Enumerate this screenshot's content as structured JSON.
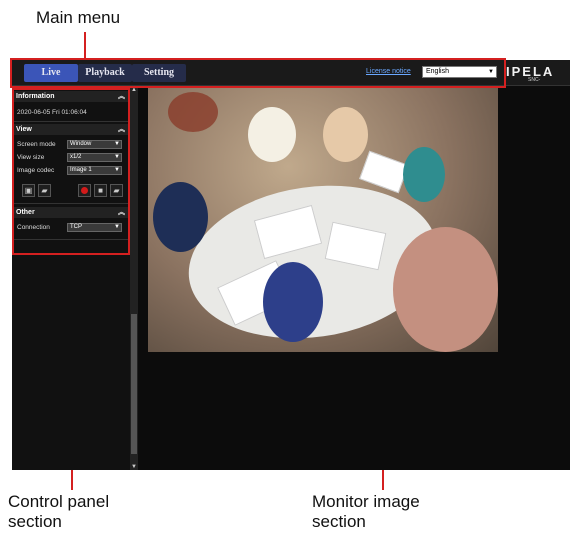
{
  "callouts": {
    "main_menu": "Main menu",
    "control_panel_line1": "Control panel",
    "control_panel_line2": "section",
    "monitor_line1": "Monitor image",
    "monitor_line2": "section"
  },
  "menu": {
    "tabs": [
      {
        "label": "Live",
        "active": true
      },
      {
        "label": "Playback",
        "active": false
      },
      {
        "label": "Setting",
        "active": false
      }
    ],
    "license_link": "License notice",
    "language": "English",
    "logo": "IPELA",
    "logo_sub": "SNC-"
  },
  "panel": {
    "information": {
      "title": "Information",
      "datetime": "2020-06-05 Fri 01:06:04"
    },
    "view": {
      "title": "View",
      "rows": [
        {
          "label": "Screen mode",
          "value": "Window"
        },
        {
          "label": "View size",
          "value": "x1/2"
        },
        {
          "label": "Image codec",
          "value": "Image 1"
        }
      ]
    },
    "other": {
      "title": "Other",
      "rows": [
        {
          "label": "Connection",
          "value": "TCP"
        }
      ]
    }
  },
  "colors": {
    "annotation_red": "#d42020",
    "active_tab": "#3b55b8",
    "link": "#6aa8ff"
  }
}
